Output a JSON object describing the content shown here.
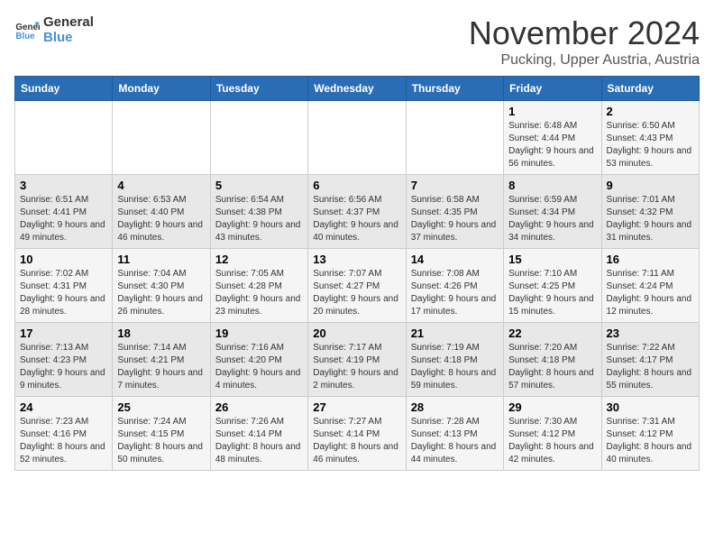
{
  "logo": {
    "line1": "General",
    "line2": "Blue"
  },
  "title": "November 2024",
  "location": "Pucking, Upper Austria, Austria",
  "weekdays": [
    "Sunday",
    "Monday",
    "Tuesday",
    "Wednesday",
    "Thursday",
    "Friday",
    "Saturday"
  ],
  "weeks": [
    [
      {
        "day": "",
        "info": ""
      },
      {
        "day": "",
        "info": ""
      },
      {
        "day": "",
        "info": ""
      },
      {
        "day": "",
        "info": ""
      },
      {
        "day": "",
        "info": ""
      },
      {
        "day": "1",
        "info": "Sunrise: 6:48 AM\nSunset: 4:44 PM\nDaylight: 9 hours and 56 minutes."
      },
      {
        "day": "2",
        "info": "Sunrise: 6:50 AM\nSunset: 4:43 PM\nDaylight: 9 hours and 53 minutes."
      }
    ],
    [
      {
        "day": "3",
        "info": "Sunrise: 6:51 AM\nSunset: 4:41 PM\nDaylight: 9 hours and 49 minutes."
      },
      {
        "day": "4",
        "info": "Sunrise: 6:53 AM\nSunset: 4:40 PM\nDaylight: 9 hours and 46 minutes."
      },
      {
        "day": "5",
        "info": "Sunrise: 6:54 AM\nSunset: 4:38 PM\nDaylight: 9 hours and 43 minutes."
      },
      {
        "day": "6",
        "info": "Sunrise: 6:56 AM\nSunset: 4:37 PM\nDaylight: 9 hours and 40 minutes."
      },
      {
        "day": "7",
        "info": "Sunrise: 6:58 AM\nSunset: 4:35 PM\nDaylight: 9 hours and 37 minutes."
      },
      {
        "day": "8",
        "info": "Sunrise: 6:59 AM\nSunset: 4:34 PM\nDaylight: 9 hours and 34 minutes."
      },
      {
        "day": "9",
        "info": "Sunrise: 7:01 AM\nSunset: 4:32 PM\nDaylight: 9 hours and 31 minutes."
      }
    ],
    [
      {
        "day": "10",
        "info": "Sunrise: 7:02 AM\nSunset: 4:31 PM\nDaylight: 9 hours and 28 minutes."
      },
      {
        "day": "11",
        "info": "Sunrise: 7:04 AM\nSunset: 4:30 PM\nDaylight: 9 hours and 26 minutes."
      },
      {
        "day": "12",
        "info": "Sunrise: 7:05 AM\nSunset: 4:28 PM\nDaylight: 9 hours and 23 minutes."
      },
      {
        "day": "13",
        "info": "Sunrise: 7:07 AM\nSunset: 4:27 PM\nDaylight: 9 hours and 20 minutes."
      },
      {
        "day": "14",
        "info": "Sunrise: 7:08 AM\nSunset: 4:26 PM\nDaylight: 9 hours and 17 minutes."
      },
      {
        "day": "15",
        "info": "Sunrise: 7:10 AM\nSunset: 4:25 PM\nDaylight: 9 hours and 15 minutes."
      },
      {
        "day": "16",
        "info": "Sunrise: 7:11 AM\nSunset: 4:24 PM\nDaylight: 9 hours and 12 minutes."
      }
    ],
    [
      {
        "day": "17",
        "info": "Sunrise: 7:13 AM\nSunset: 4:23 PM\nDaylight: 9 hours and 9 minutes."
      },
      {
        "day": "18",
        "info": "Sunrise: 7:14 AM\nSunset: 4:21 PM\nDaylight: 9 hours and 7 minutes."
      },
      {
        "day": "19",
        "info": "Sunrise: 7:16 AM\nSunset: 4:20 PM\nDaylight: 9 hours and 4 minutes."
      },
      {
        "day": "20",
        "info": "Sunrise: 7:17 AM\nSunset: 4:19 PM\nDaylight: 9 hours and 2 minutes."
      },
      {
        "day": "21",
        "info": "Sunrise: 7:19 AM\nSunset: 4:18 PM\nDaylight: 8 hours and 59 minutes."
      },
      {
        "day": "22",
        "info": "Sunrise: 7:20 AM\nSunset: 4:18 PM\nDaylight: 8 hours and 57 minutes."
      },
      {
        "day": "23",
        "info": "Sunrise: 7:22 AM\nSunset: 4:17 PM\nDaylight: 8 hours and 55 minutes."
      }
    ],
    [
      {
        "day": "24",
        "info": "Sunrise: 7:23 AM\nSunset: 4:16 PM\nDaylight: 8 hours and 52 minutes."
      },
      {
        "day": "25",
        "info": "Sunrise: 7:24 AM\nSunset: 4:15 PM\nDaylight: 8 hours and 50 minutes."
      },
      {
        "day": "26",
        "info": "Sunrise: 7:26 AM\nSunset: 4:14 PM\nDaylight: 8 hours and 48 minutes."
      },
      {
        "day": "27",
        "info": "Sunrise: 7:27 AM\nSunset: 4:14 PM\nDaylight: 8 hours and 46 minutes."
      },
      {
        "day": "28",
        "info": "Sunrise: 7:28 AM\nSunset: 4:13 PM\nDaylight: 8 hours and 44 minutes."
      },
      {
        "day": "29",
        "info": "Sunrise: 7:30 AM\nSunset: 4:12 PM\nDaylight: 8 hours and 42 minutes."
      },
      {
        "day": "30",
        "info": "Sunrise: 7:31 AM\nSunset: 4:12 PM\nDaylight: 8 hours and 40 minutes."
      }
    ]
  ]
}
